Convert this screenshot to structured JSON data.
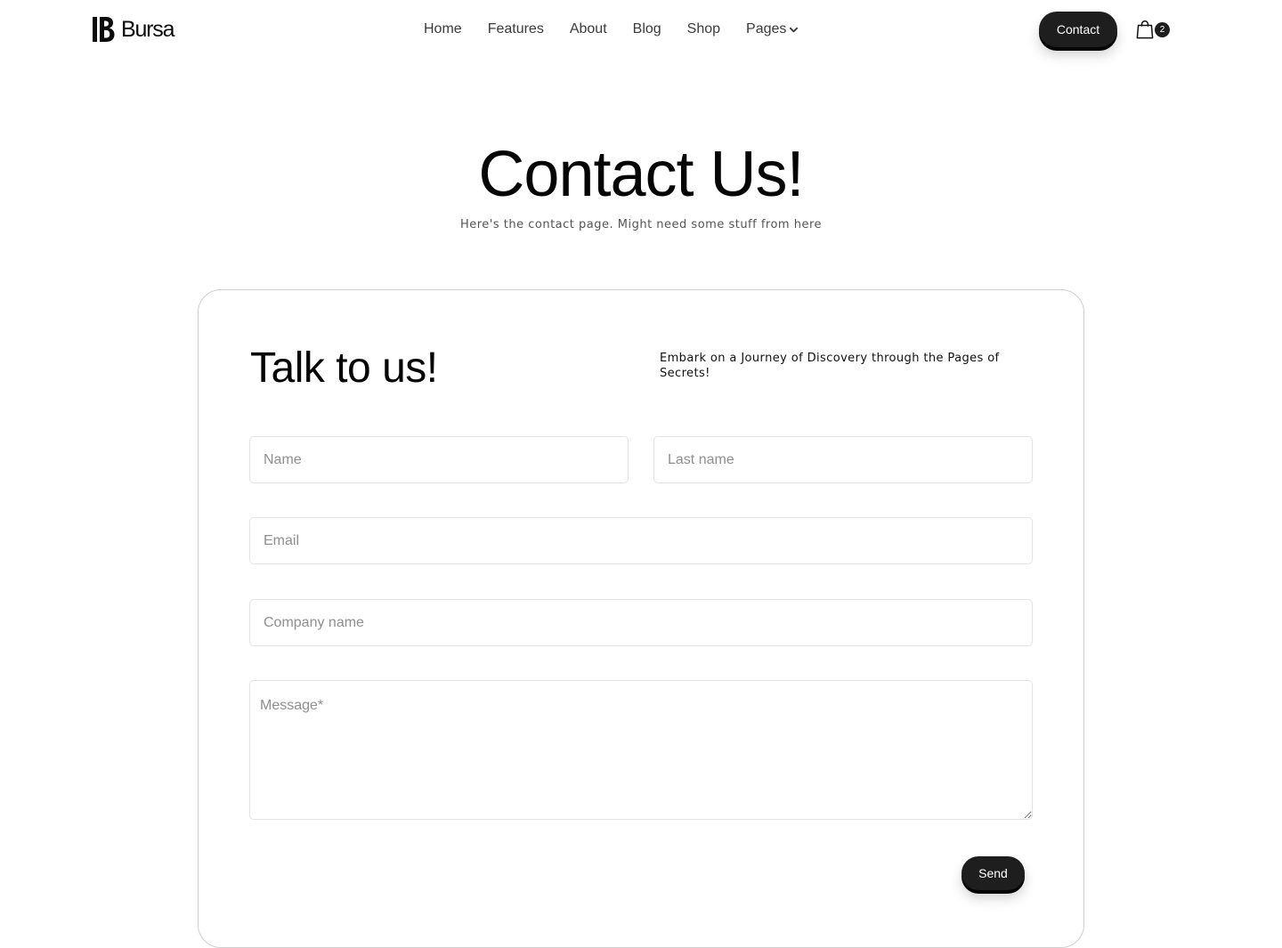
{
  "brand": {
    "name": "Bursa",
    "logo_icon": "bursa-logo-mark"
  },
  "nav": {
    "items": [
      {
        "label": "Home"
      },
      {
        "label": "Features"
      },
      {
        "label": "About"
      },
      {
        "label": "Blog"
      },
      {
        "label": "Shop"
      },
      {
        "label": "Pages",
        "icon": "chevron-down-icon"
      }
    ]
  },
  "header": {
    "contact_label": "Contact",
    "cart_icon": "shopping-bag-icon",
    "cart_count": "2"
  },
  "hero": {
    "title": "Contact Us!",
    "subtitle": "Here's the contact page. Might need some stuff from here"
  },
  "form": {
    "title": "Talk to us!",
    "description": "Embark on a Journey of Discovery through the Pages of Secrets!",
    "fields": {
      "first_name": {
        "placeholder": "Name",
        "value": ""
      },
      "last_name": {
        "placeholder": "Last name",
        "value": ""
      },
      "email": {
        "placeholder": "Email",
        "value": ""
      },
      "company": {
        "placeholder": "Company name",
        "value": ""
      },
      "message": {
        "placeholder": "Message*",
        "value": ""
      }
    },
    "submit_label": "Send"
  },
  "colors": {
    "text": "#050505",
    "button_bg": "#1e1e1e",
    "button_text": "#ffffff",
    "border": "#e3e3e3",
    "card_border": "#cfcfcf",
    "placeholder": "#8f8f8f"
  }
}
